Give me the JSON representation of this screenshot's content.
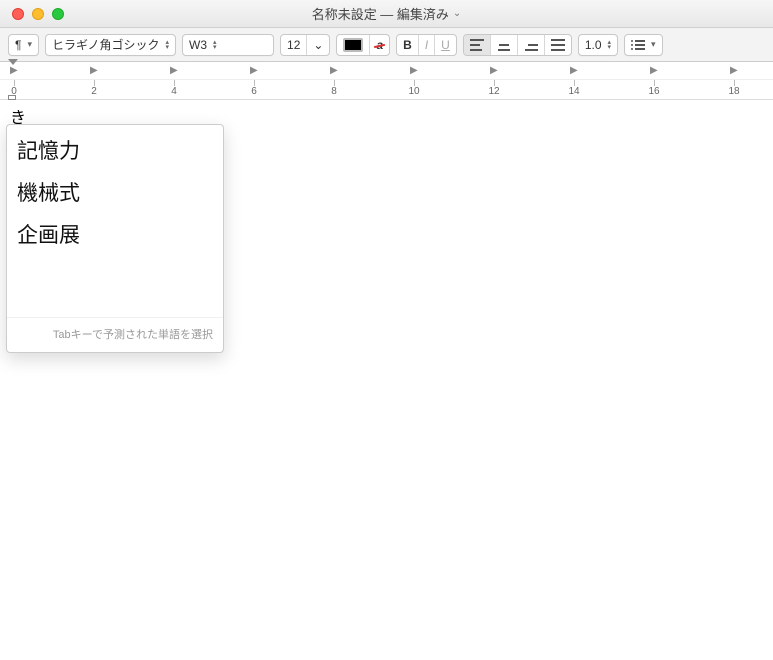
{
  "window": {
    "title": "名称未設定 — 編集済み"
  },
  "toolbar": {
    "paragraph_menu_glyph": "¶",
    "font_family": "ヒラギノ角ゴシック",
    "font_weight": "W3",
    "font_size": "12",
    "highlight_glyph": "a",
    "bold": "B",
    "italic": "I",
    "underline": "U",
    "line_spacing": "1.0"
  },
  "ruler": {
    "labels": [
      "0",
      "2",
      "4",
      "6",
      "8",
      "10",
      "12",
      "14",
      "16",
      "18"
    ]
  },
  "document": {
    "typed_text": "き"
  },
  "autocomplete": {
    "options": [
      "記憶力",
      "機械式",
      "企画展"
    ],
    "hint": "Tabキーで予測された単語を選択"
  }
}
